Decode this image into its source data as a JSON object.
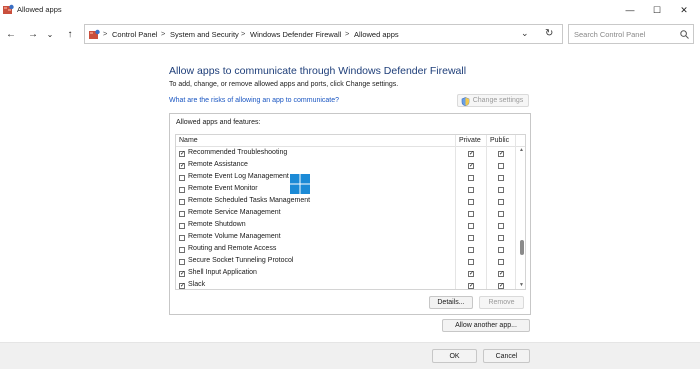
{
  "window": {
    "title": "Allowed apps",
    "minimize": "—",
    "maximize": "☐",
    "close": "✕"
  },
  "nav": {
    "back": "←",
    "forward": "→",
    "recent": "⌄",
    "up": "↑"
  },
  "address": {
    "crumbs": [
      "Control Panel",
      "System and Security",
      "Windows Defender Firewall",
      "Allowed apps"
    ],
    "separator": ">",
    "dropdown": "⌄",
    "refresh": "↻"
  },
  "search": {
    "placeholder": "Search Control Panel"
  },
  "main": {
    "heading": "Allow apps to communicate through Windows Defender Firewall",
    "subtext": "To add, change, or remove allowed apps and ports, click Change settings.",
    "risk_link": "What are the risks of allowing an app to communicate?",
    "change_settings": "Change settings",
    "group_label": "Allowed apps and features:",
    "columns": {
      "name": "Name",
      "private": "Private",
      "public": "Public"
    },
    "rows": [
      {
        "name": "Recommended Troubleshooting",
        "enabled": true,
        "private": true,
        "public": true
      },
      {
        "name": "Remote Assistance",
        "enabled": true,
        "private": true,
        "public": false
      },
      {
        "name": "Remote Event Log Management",
        "enabled": false,
        "private": false,
        "public": false
      },
      {
        "name": "Remote Event Monitor",
        "enabled": false,
        "private": false,
        "public": false
      },
      {
        "name": "Remote Scheduled Tasks Management",
        "enabled": false,
        "private": false,
        "public": false
      },
      {
        "name": "Remote Service Management",
        "enabled": false,
        "private": false,
        "public": false
      },
      {
        "name": "Remote Shutdown",
        "enabled": false,
        "private": false,
        "public": false
      },
      {
        "name": "Remote Volume Management",
        "enabled": false,
        "private": false,
        "public": false
      },
      {
        "name": "Routing and Remote Access",
        "enabled": false,
        "private": false,
        "public": false
      },
      {
        "name": "Secure Socket Tunneling Protocol",
        "enabled": false,
        "private": false,
        "public": false
      },
      {
        "name": "Shell Input Application",
        "enabled": true,
        "private": true,
        "public": true
      },
      {
        "name": "Slack",
        "enabled": true,
        "private": true,
        "public": true
      }
    ],
    "details": "Details...",
    "remove": "Remove",
    "allow_another": "Allow another app..."
  },
  "footer": {
    "ok": "OK",
    "cancel": "Cancel"
  }
}
